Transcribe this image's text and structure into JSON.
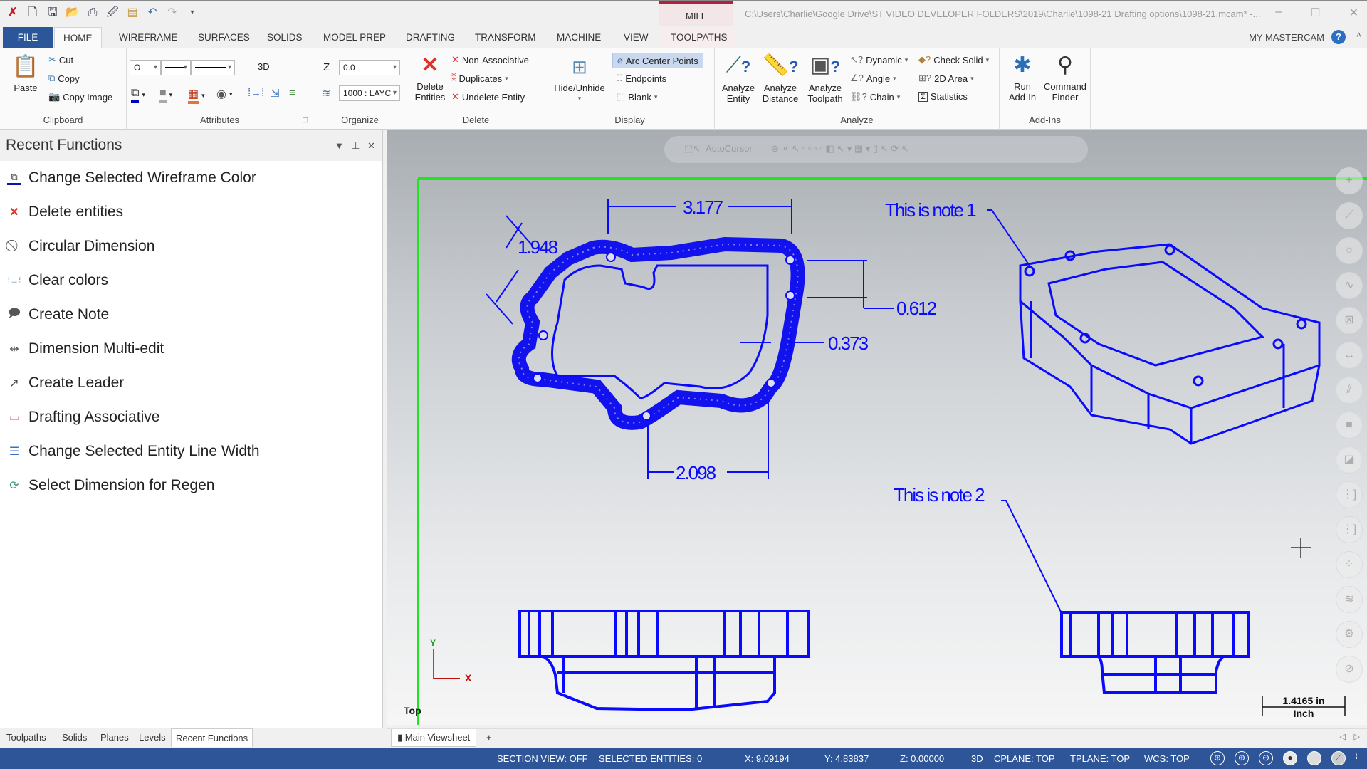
{
  "app": {
    "context_tab": "MILL",
    "title_path": "C:\\Users\\Charlie\\Google Drive\\ST VIDEO DEVELOPER FOLDERS\\2019\\Charlie\\1098-21 Drafting options\\1098-21.mcam* -...",
    "window_controls": {
      "minimize": "–",
      "maximize": "☐",
      "close": "✕"
    },
    "my_mastercam": "MY MASTERCAM",
    "help": "?",
    "collapse": "˄"
  },
  "quick_access": [
    "logo-icon",
    "new-icon",
    "save-icon",
    "open-icon",
    "print-icon",
    "save-as-icon",
    "folder-icon",
    "undo-icon",
    "redo-icon",
    "customize-icon"
  ],
  "tabs": [
    {
      "label": "FILE"
    },
    {
      "label": "HOME",
      "active": true
    },
    {
      "label": "WIREFRAME"
    },
    {
      "label": "SURFACES"
    },
    {
      "label": "SOLIDS"
    },
    {
      "label": "MODEL PREP"
    },
    {
      "label": "DRAFTING"
    },
    {
      "label": "TRANSFORM"
    },
    {
      "label": "MACHINE"
    },
    {
      "label": "VIEW"
    },
    {
      "label": "TOOLPATHS"
    }
  ],
  "ribbon": {
    "clipboard": {
      "label": "Clipboard",
      "paste": "Paste",
      "cut": "Cut",
      "copy": "Copy",
      "copy_image": "Copy Image"
    },
    "attributes": {
      "label": "Attributes",
      "point_style": "O",
      "mode": "3D"
    },
    "organize": {
      "label": "Organize",
      "z_label": "Z",
      "z_value": "0.0",
      "level_value": "1000 : LAYC"
    },
    "delete": {
      "label": "Delete",
      "delete_entities": "Delete Entities",
      "non_associative": "Non-Associative",
      "duplicates": "Duplicates",
      "undelete": "Undelete Entity"
    },
    "display": {
      "label": "Display",
      "hide_unhide": "Hide/Unhide",
      "arc_center_points": "Arc Center Points",
      "endpoints": "Endpoints",
      "blank": "Blank"
    },
    "analyze": {
      "label": "Analyze",
      "analyze_entity": "Analyze Entity",
      "analyze_distance": "Analyze Distance",
      "analyze_toolpath": "Analyze Toolpath",
      "dynamic": "Dynamic",
      "angle": "Angle",
      "chain": "Chain",
      "check_solid": "Check Solid",
      "area_2d": "2D Area",
      "statistics": "Statistics"
    },
    "addins": {
      "label": "Add-Ins",
      "run_addin": "Run Add-In",
      "command_finder": "Command Finder"
    }
  },
  "panel": {
    "title": "Recent Functions",
    "items": [
      {
        "label": "Change Selected Wireframe Color",
        "icon": "wireframe-color-icon"
      },
      {
        "label": "Delete entities",
        "icon": "delete-icon"
      },
      {
        "label": "Circular Dimension",
        "icon": "circular-dimension-icon"
      },
      {
        "label": "Clear colors",
        "icon": "clear-colors-icon"
      },
      {
        "label": "Create Note",
        "icon": "note-icon"
      },
      {
        "label": "Dimension Multi-edit",
        "icon": "dimension-multi-edit-icon"
      },
      {
        "label": "Create Leader",
        "icon": "leader-icon"
      },
      {
        "label": "Drafting Associative",
        "icon": "drafting-associative-icon"
      },
      {
        "label": "Change Selected Entity Line Width",
        "icon": "line-width-icon"
      },
      {
        "label": "Select Dimension for Regen",
        "icon": "regen-icon"
      }
    ],
    "bottom_tabs": [
      {
        "label": "Toolpaths"
      },
      {
        "label": "Solids"
      },
      {
        "label": "Planes"
      },
      {
        "label": "Levels"
      },
      {
        "label": "Recent Functions",
        "active": true
      }
    ]
  },
  "viewport": {
    "autocursor": "AutoCursor",
    "dimensions": {
      "d1": "3.177",
      "d2": "1.948",
      "d3": "0.612",
      "d4": "0.373",
      "d5": "2.098"
    },
    "notes": {
      "note1": "This is note 1",
      "note2": "This is note 2"
    },
    "axis": {
      "x": "X",
      "y": "Y"
    },
    "view_name": "Top",
    "scale": {
      "value": "1.4165 in",
      "unit": "Inch"
    },
    "viewsheet_tab": "Main Viewsheet",
    "add_viewsheet": "+",
    "colors": {
      "geometry": "#0a0aff",
      "border": "#1ee61e"
    }
  },
  "status": {
    "section_view": "SECTION VIEW: OFF",
    "selected": "SELECTED ENTITIES: 0",
    "x": "X:  9.09194",
    "y": "Y:  4.83837",
    "z": "Z:  0.00000",
    "mode": "3D",
    "cplane": "CPLANE: TOP",
    "tplane": "TPLANE: TOP",
    "wcs": "WCS: TOP"
  }
}
